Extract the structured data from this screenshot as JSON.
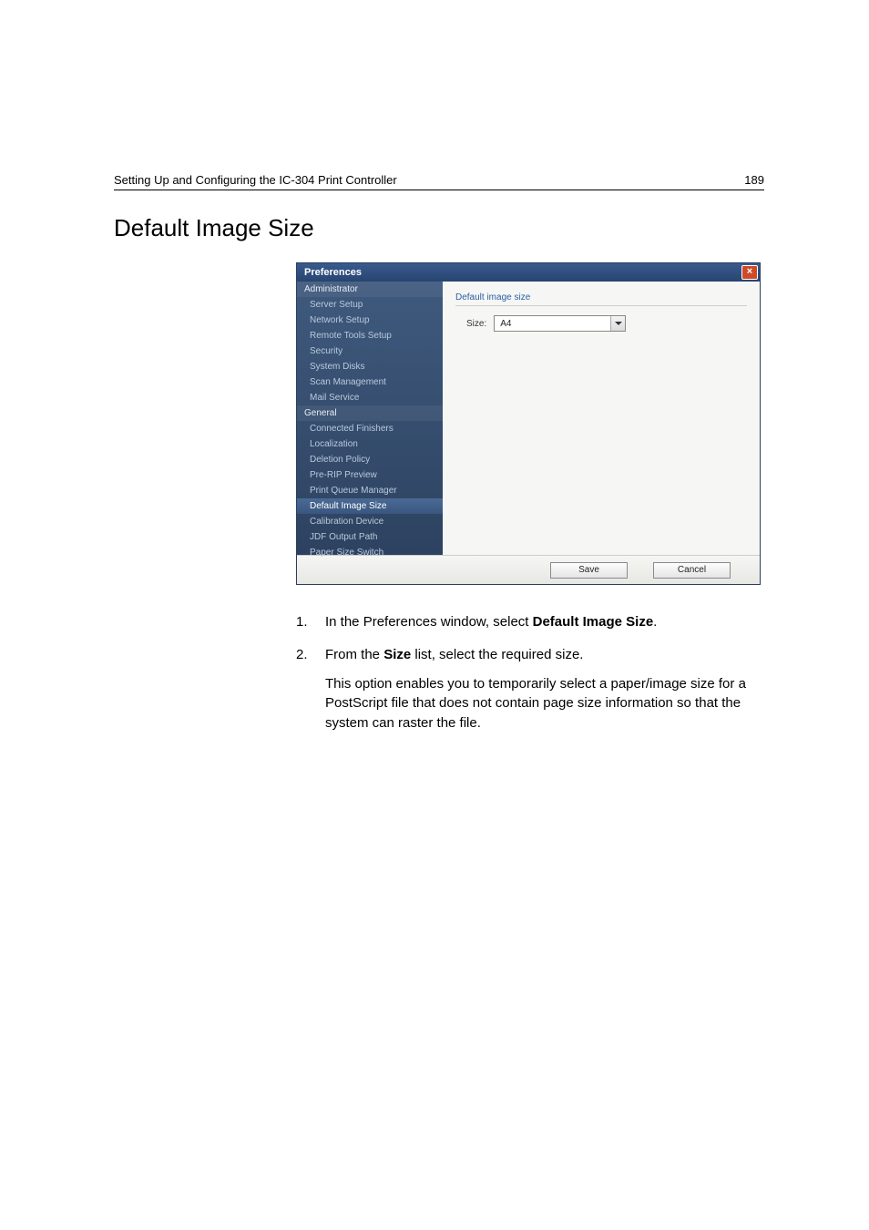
{
  "header": {
    "left": "Setting Up and Configuring the IC-304 Print Controller",
    "page_number": "189"
  },
  "section_title": "Default Image Size",
  "preferences_window": {
    "title": "Preferences",
    "close_glyph": "×",
    "sidebar": {
      "groups": [
        {
          "label": "Administrator",
          "items": [
            "Server Setup",
            "Network Setup",
            "Remote Tools Setup",
            "Security",
            "System Disks",
            "Scan Management",
            "Mail Service"
          ]
        },
        {
          "label": "General",
          "items": [
            "Connected Finishers",
            "Localization",
            "Deletion Policy",
            "Pre-RIP Preview",
            "Print Queue Manager",
            "Default Image Size",
            "Calibration Device",
            "JDF Output Path",
            "Paper Size Switch"
          ]
        }
      ],
      "selected": "Default Image Size"
    },
    "content": {
      "heading": "Default image size",
      "size_label": "Size:",
      "size_value": "A4"
    },
    "buttons": {
      "save": "Save",
      "cancel": "Cancel"
    }
  },
  "instructions": {
    "step1_pre": "In the Preferences window, select ",
    "step1_bold": "Default Image Size",
    "step1_post": ".",
    "step2_pre": "From the ",
    "step2_bold": "Size",
    "step2_post": " list, select the required size.",
    "step2_note": "This option enables you to temporarily select a paper/image size for a PostScript file that does not contain page size information so that the system can raster the file."
  }
}
